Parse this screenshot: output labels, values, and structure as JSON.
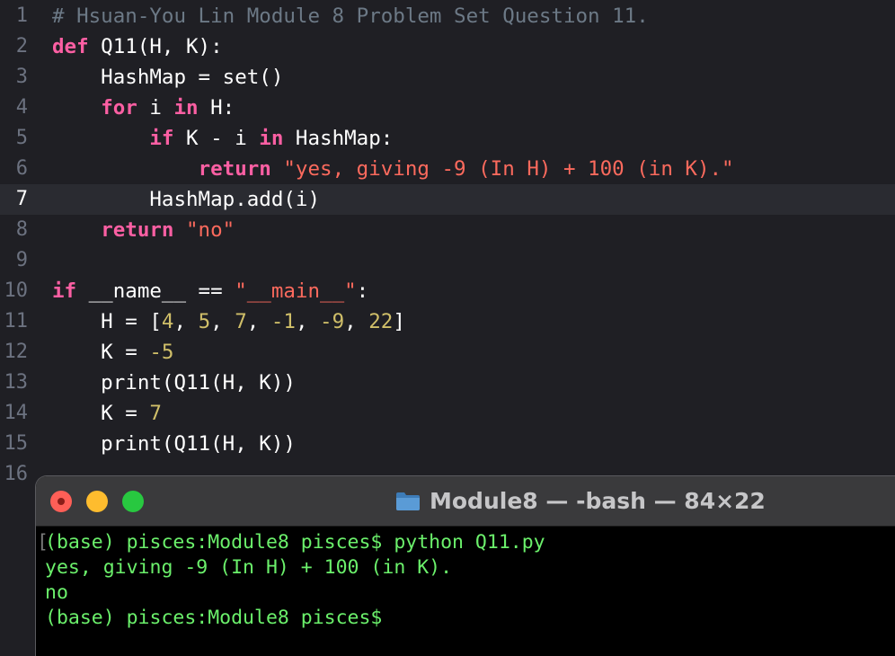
{
  "editor": {
    "current_line": 7,
    "lines": [
      {
        "num": "1",
        "tokens": [
          {
            "t": "# Hsuan-You Lin Module 8 Problem Set Question 11.",
            "c": "cmt"
          }
        ]
      },
      {
        "num": "2",
        "tokens": [
          {
            "t": "def",
            "c": "kw"
          },
          {
            "t": " Q11(H, K):",
            "c": ""
          }
        ]
      },
      {
        "num": "3",
        "tokens": [
          {
            "t": "    HashMap = set()",
            "c": ""
          }
        ]
      },
      {
        "num": "4",
        "tokens": [
          {
            "t": "    ",
            "c": ""
          },
          {
            "t": "for",
            "c": "kw"
          },
          {
            "t": " i ",
            "c": ""
          },
          {
            "t": "in",
            "c": "kw"
          },
          {
            "t": " H:",
            "c": ""
          }
        ]
      },
      {
        "num": "5",
        "tokens": [
          {
            "t": "        ",
            "c": ""
          },
          {
            "t": "if",
            "c": "kw"
          },
          {
            "t": " K - i ",
            "c": ""
          },
          {
            "t": "in",
            "c": "kw"
          },
          {
            "t": " HashMap:",
            "c": ""
          }
        ]
      },
      {
        "num": "6",
        "tokens": [
          {
            "t": "            ",
            "c": ""
          },
          {
            "t": "return",
            "c": "kw"
          },
          {
            "t": " ",
            "c": ""
          },
          {
            "t": "\"yes, giving -9 (In H) + 100 (in K).\"",
            "c": "str"
          }
        ]
      },
      {
        "num": "7",
        "tokens": [
          {
            "t": "        HashMap.add(i)",
            "c": ""
          }
        ]
      },
      {
        "num": "8",
        "tokens": [
          {
            "t": "    ",
            "c": ""
          },
          {
            "t": "return",
            "c": "kw"
          },
          {
            "t": " ",
            "c": ""
          },
          {
            "t": "\"no\"",
            "c": "str"
          }
        ]
      },
      {
        "num": "9",
        "tokens": []
      },
      {
        "num": "10",
        "tokens": [
          {
            "t": "if",
            "c": "kw"
          },
          {
            "t": " __name__ == ",
            "c": ""
          },
          {
            "t": "\"__main__\"",
            "c": "str"
          },
          {
            "t": ":",
            "c": ""
          }
        ]
      },
      {
        "num": "11",
        "tokens": [
          {
            "t": "    H = [",
            "c": ""
          },
          {
            "t": "4",
            "c": "num"
          },
          {
            "t": ", ",
            "c": ""
          },
          {
            "t": "5",
            "c": "num"
          },
          {
            "t": ", ",
            "c": ""
          },
          {
            "t": "7",
            "c": "num"
          },
          {
            "t": ", ",
            "c": ""
          },
          {
            "t": "-1",
            "c": "num"
          },
          {
            "t": ", ",
            "c": ""
          },
          {
            "t": "-9",
            "c": "num"
          },
          {
            "t": ", ",
            "c": ""
          },
          {
            "t": "22",
            "c": "num"
          },
          {
            "t": "]",
            "c": ""
          }
        ]
      },
      {
        "num": "12",
        "tokens": [
          {
            "t": "    K = ",
            "c": ""
          },
          {
            "t": "-5",
            "c": "num"
          }
        ]
      },
      {
        "num": "13",
        "tokens": [
          {
            "t": "    print(Q11(H, K))",
            "c": ""
          }
        ]
      },
      {
        "num": "14",
        "tokens": [
          {
            "t": "    K = ",
            "c": ""
          },
          {
            "t": "7",
            "c": "num"
          }
        ]
      },
      {
        "num": "15",
        "tokens": [
          {
            "t": "    print(Q11(H, K))",
            "c": ""
          }
        ]
      },
      {
        "num": "16",
        "tokens": []
      }
    ]
  },
  "terminal": {
    "title": "Module8 — -bash — 84×22",
    "folder_icon": "folder-icon",
    "lines": [
      "(base) pisces:Module8 pisces$ python Q11.py",
      "yes, giving -9 (In H) + 100 (in K).",
      "no",
      "(base) pisces:Module8 pisces$"
    ]
  },
  "colors": {
    "editor_bg": "#1f1f24",
    "keyword": "#fc5fa3",
    "string": "#fc6a5d",
    "number": "#d0bf69",
    "comment": "#6c7986",
    "terminal_text": "#6bf06b"
  }
}
